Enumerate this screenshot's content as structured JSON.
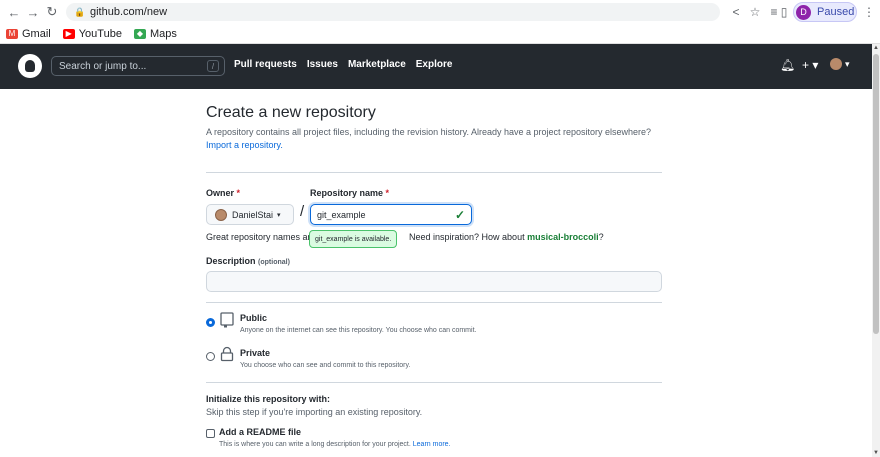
{
  "browser": {
    "url": "github.com/new",
    "profile_initial": "D",
    "profile_status": "Paused",
    "bookmarks": [
      {
        "label": "Gmail",
        "color": "#ea4335",
        "icon": "gmail-icon"
      },
      {
        "label": "YouTube",
        "color": "#ff0000",
        "icon": "youtube-icon"
      },
      {
        "label": "Maps",
        "color": "#34a853",
        "icon": "maps-icon"
      }
    ]
  },
  "header": {
    "search_placeholder": "Search or jump to...",
    "search_shortcut": "/",
    "nav": [
      "Pull requests",
      "Issues",
      "Marketplace",
      "Explore"
    ],
    "plus_label": "+ ▾",
    "avatar_caret": "▾"
  },
  "form": {
    "title": "Create a new repository",
    "subtitle": "A repository contains all project files, including the revision history. Already have a project repository elsewhere?",
    "import_link": "Import a repository.",
    "owner_label": "Owner",
    "repo_label": "Repository name",
    "required_mark": "*",
    "owner_value": "DanielStai",
    "owner_caret": "▾",
    "separator": "/",
    "repo_value": "git_example",
    "available_tooltip": "git_example is available.",
    "hint_left": "Great repository names ar",
    "hint_right": "Need inspiration? How about",
    "suggestion": "musical-broccoli",
    "hint_end": "?",
    "description_label": "Description",
    "description_optional": "(optional)",
    "visibility": [
      {
        "title": "Public",
        "desc": "Anyone on the internet can see this repository. You choose who can commit.",
        "selected": true
      },
      {
        "title": "Private",
        "desc": "You choose who can see and commit to this repository.",
        "selected": false
      }
    ],
    "init_title": "Initialize this repository with:",
    "init_sub": "Skip this step if you're importing an existing repository.",
    "readme_label": "Add a README file",
    "readme_desc": "This is where you can write a long description for your project.",
    "learn_more": "Learn more."
  },
  "colors": {
    "header_bg": "#24292f",
    "link": "#0969da",
    "success": "#1a7f37",
    "required": "#cf222e"
  }
}
